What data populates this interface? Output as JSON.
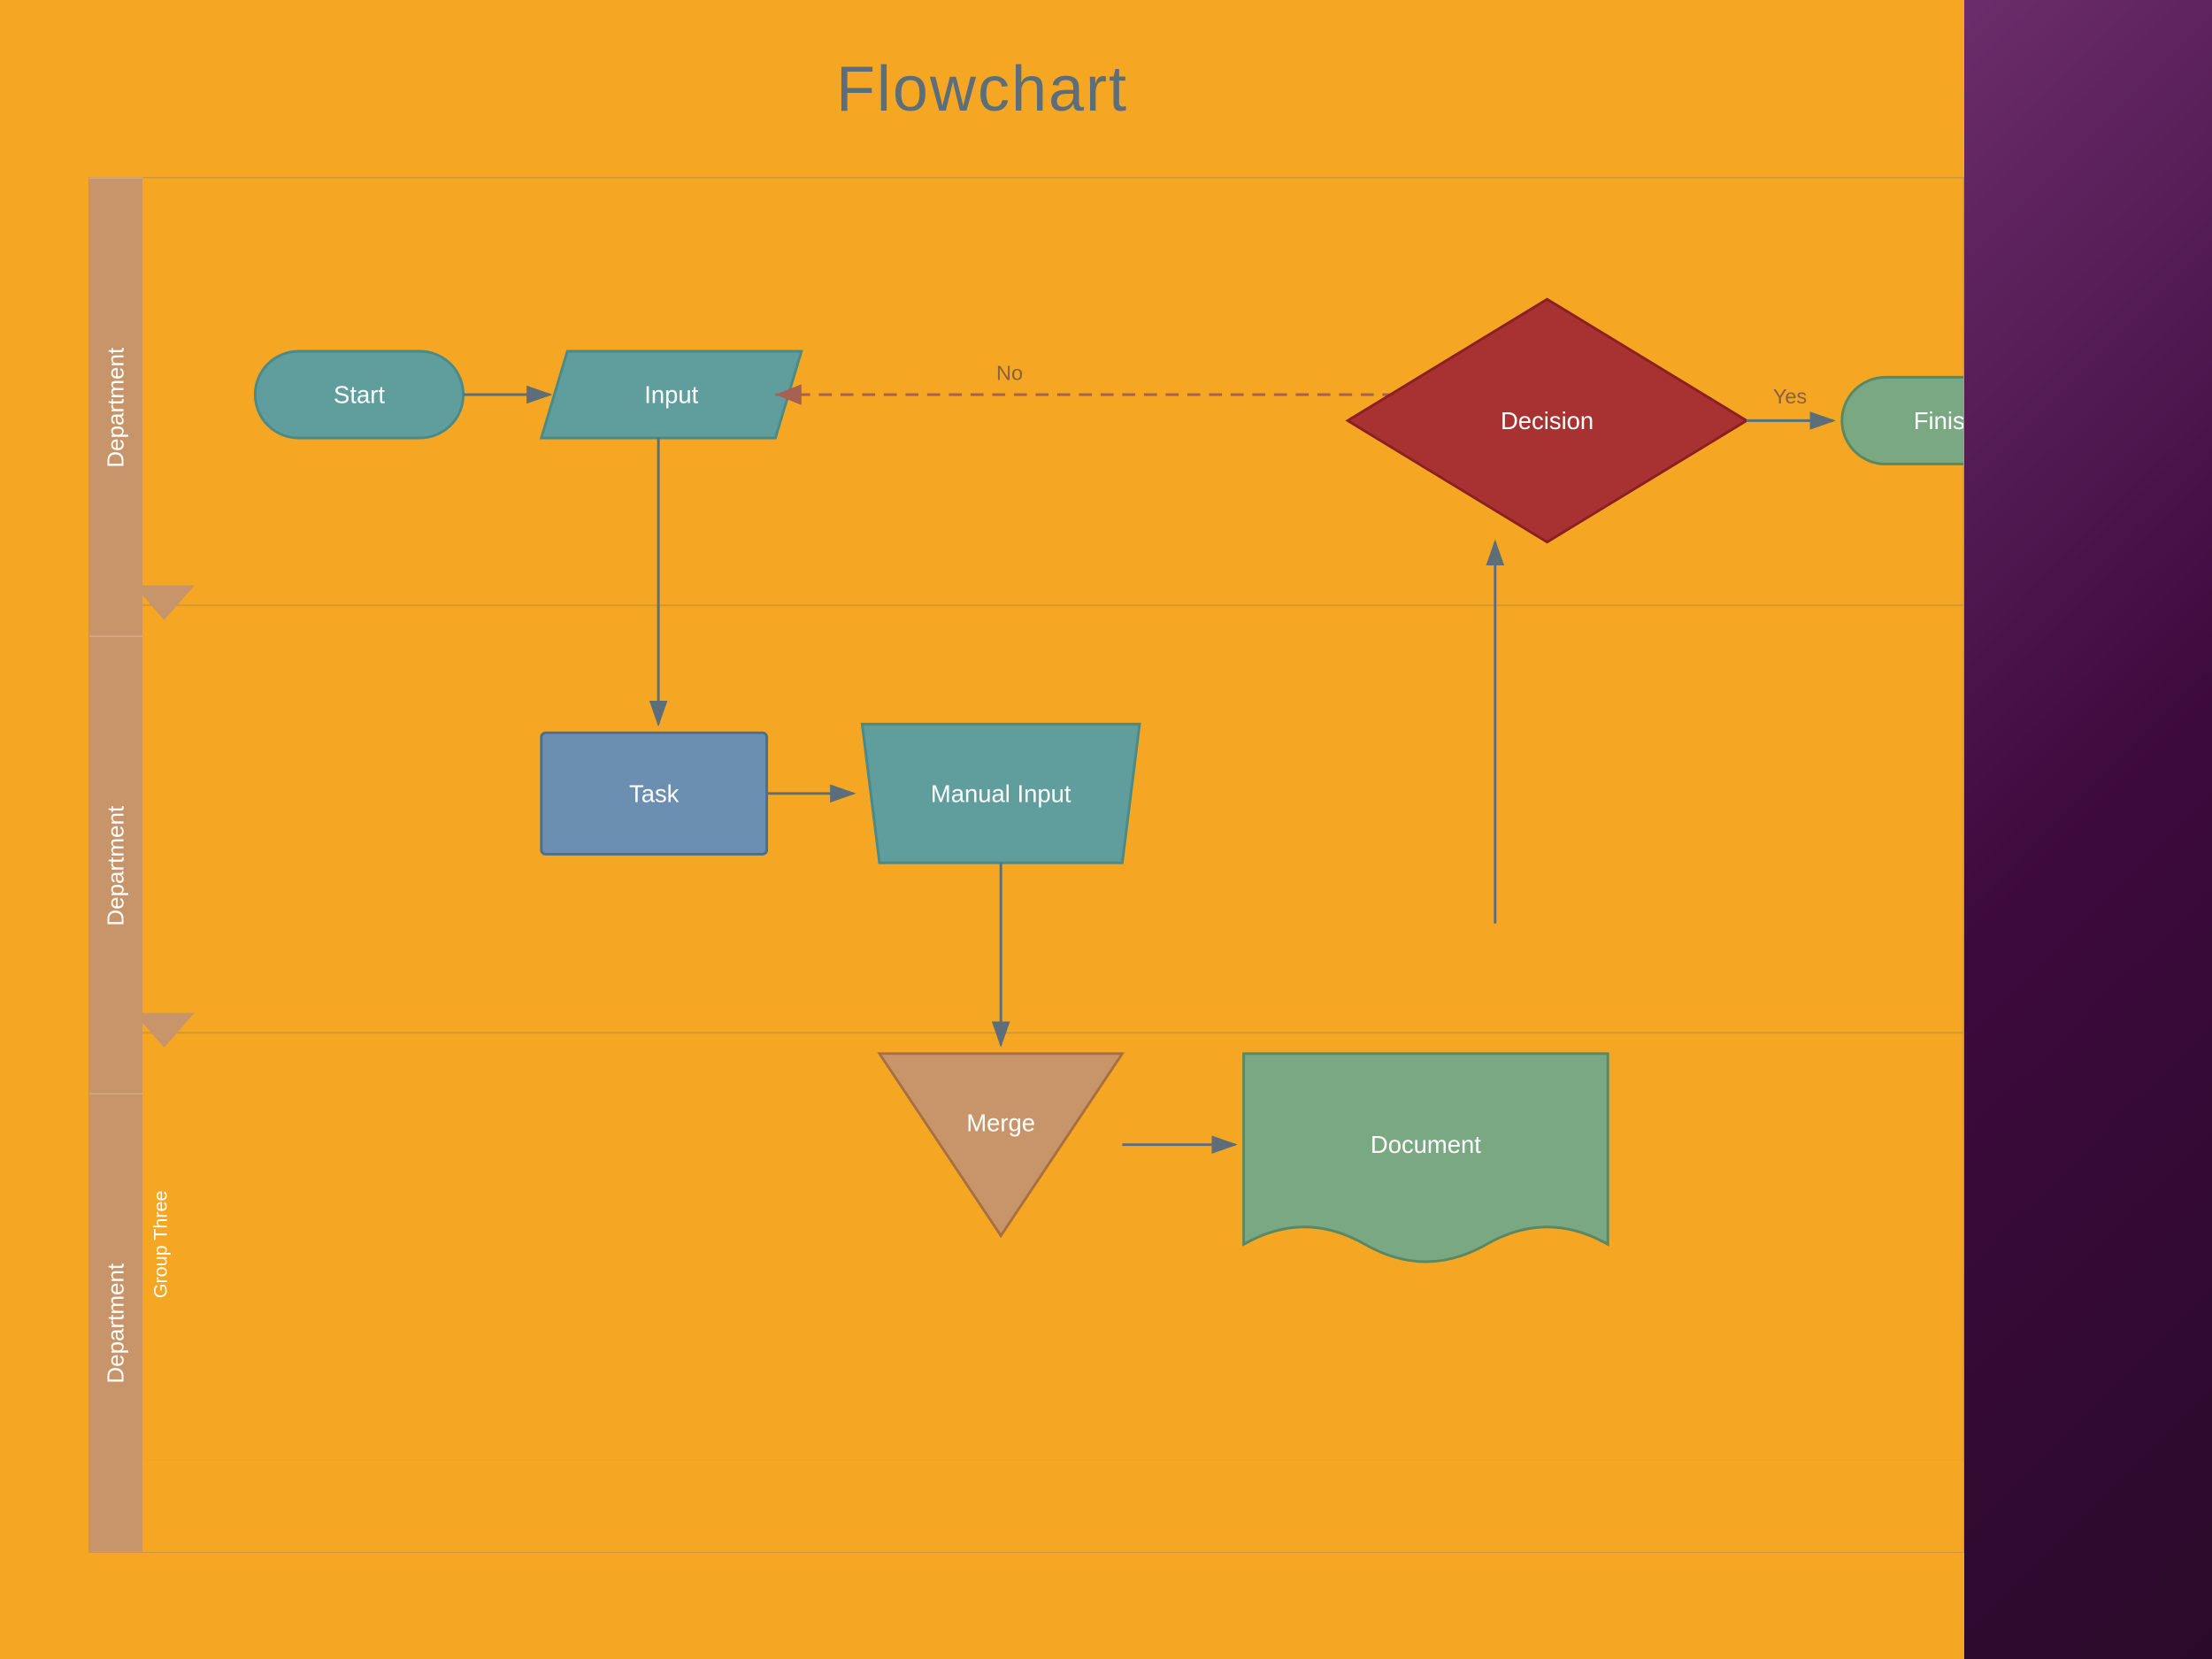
{
  "title": "Flowchart",
  "colors": {
    "background": "#F5A623",
    "rightPanel": "#6B2D6B",
    "laneLabel": "#C8956A",
    "teal": "#5F9E9D",
    "tealDark": "#4A8A89",
    "red": "#A83232",
    "brown": "#8B6040",
    "greenMuted": "#7AA882",
    "arrowColor": "#5B6E7A",
    "dashedArrow": "#A86050"
  },
  "lanes": [
    {
      "label": "Department"
    },
    {
      "label": "Department"
    },
    {
      "label": "Department"
    }
  ],
  "groupLabel": "Group Three",
  "shapes": {
    "start": "Start",
    "input": "Input",
    "decision": "Decision",
    "finish": "Finish",
    "task": "Task",
    "manualInput": "Manual Input",
    "merge": "Merge",
    "document": "Document"
  },
  "arrows": {
    "no": "No",
    "yes": "Yes"
  }
}
